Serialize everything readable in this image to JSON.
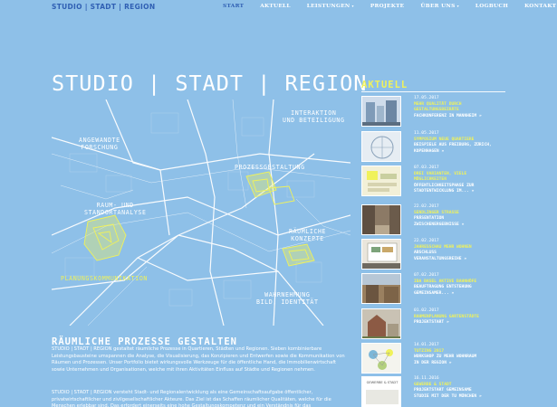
{
  "header": {
    "brand": "STUDIO | STADT | REGION",
    "nav": [
      {
        "label": "START",
        "active": true,
        "caret": false
      },
      {
        "label": "AKTUELL",
        "active": false,
        "caret": false
      },
      {
        "label": "LEISTUNGEN",
        "active": false,
        "caret": true
      },
      {
        "label": "PROJEKTE",
        "active": false,
        "caret": false
      },
      {
        "label": "ÜBER UNS",
        "active": false,
        "caret": true
      },
      {
        "label": "LOGBUCH",
        "active": false,
        "caret": false
      },
      {
        "label": "KONTAKT",
        "active": false,
        "caret": false
      }
    ],
    "caret_glyph": "▾"
  },
  "hero": {
    "title": "STUDIO | STADT | REGION",
    "labels": {
      "interaktion": [
        "INTERAKTION",
        "UND BETEILIGUNG"
      ],
      "angewandte": [
        "ANGEWANDTE",
        "FORSCHUNG"
      ],
      "prozess": [
        "PROZESSGESTALTUNG"
      ],
      "raum": [
        "RAUM- UND",
        "STANDORTANALYSE"
      ],
      "konzepte": [
        "RÄUMLICHE",
        "KONZEPTE"
      ],
      "planung": [
        "PLANUNGSKOMMUNIKATION"
      ],
      "wahrnehmung": [
        "WAHRNEHMUNG",
        "BILD, IDENTITÄT"
      ]
    }
  },
  "main": {
    "heading": "RÄUMLICHE PROZESSE GESTALTEN",
    "para1": "STUDIO | STADT | REGION gestaltet räumliche Prozesse in Quartieren, Städten und Regionen. Sieben kombinierbare Leistungsbausteine umspannen die Analyse, die Visualisierung, das Konzipieren und Entwerfen sowie die Kommunikation von Räumen und Prozessen. Unser Portfolio bietet wirkungsvolle Werkzeuge für die öffentliche Hand, die Immobilienwirtschaft sowie Unternehmen und Organisationen, welche mit ihren Aktivitäten Einfluss auf Städte und Regionen nehmen.",
    "para2": "STUDIO | STADT | REGION versteht Stadt- und Regionalentwicklung als eine Gemeinschaftsaufgabe öffentlicher, privatwirtschaftlicher und zivilgesellschaftlicher Akteure. Das Ziel ist das Schaffen räumlicher Qualitäten, welche für die Menschen erlebbar sind. Das erfordert einerseits eine hohe Gestaltungskompetenz und ein Verständnis für das"
  },
  "sidebar": {
    "title": "AKTUELL",
    "arrow": "»",
    "news": [
      {
        "date": "17.05.2017",
        "head": [
          "MEHR QUALITÄT DURCH",
          "GESTALTUNGSBEIRÄTE"
        ],
        "sub": [
          "FACHKONFERENZ IN MANNHEIM"
        ]
      },
      {
        "date": "11.05.2017",
        "head": [
          "SYMPOSIUM NEUE QUARTIERE"
        ],
        "sub": [
          "BEISPIELE AUS FREIBURG, ZÜRICH,",
          "KOPENHAGEN"
        ]
      },
      {
        "date": "07.03.2017",
        "head": [
          "DREI VARIANTEN, VIELE",
          "MÖGLICHKEITEN"
        ],
        "sub": [
          "ÖFFENTLICHKEITSPHASE ZUR",
          "STADTENTWICKLUNG IM..."
        ]
      },
      {
        "date": "22.02.2017",
        "head": [
          "SENDLINGER STRASSE"
        ],
        "sub": [
          "PRÄSENTATION",
          "ZWISCHENERGEBNISSE"
        ]
      },
      {
        "date": "22.02.2017",
        "head": [
          "JAHRESSCHAU MEHR WOHNEN"
        ],
        "sub": [
          "ABSCHLUSS",
          "VERANSTALTUNGSREIHE"
        ]
      },
      {
        "date": "07.02.2017",
        "head": [
          "IBA BASEL AKTIVE BAHNHÖFE"
        ],
        "sub": [
          "BEAUFTRAGUNG ENTSTEHUNG",
          "GEMEINSAMER..."
        ]
      },
      {
        "date": "01.02.2017",
        "head": [
          "RAHMENPLANUNG GARTENSTÄDTE"
        ],
        "sub": [
          "PROJEKTSTART"
        ]
      },
      {
        "date": "14.01.2017",
        "head": [
          "TUTZING 2017"
        ],
        "sub": [
          "WORKSHOP ZU MEHR WOHNRAUM",
          "IN DER REGION"
        ]
      },
      {
        "date": "16.11.2016",
        "head": [
          "GEWERBE & STADT"
        ],
        "sub": [
          "PROJEKTSTART GEMEINSAME",
          "STUDIE MIT DER TU MÜNCHEN"
        ]
      }
    ],
    "thumb_labels": {
      "thumb8": "GEWERBE & STADT"
    }
  },
  "colors": {
    "background": "#8ec0e8",
    "accent_yellow": "#f0f25a",
    "brand_blue": "#2f5fb3",
    "white": "#ffffff"
  }
}
